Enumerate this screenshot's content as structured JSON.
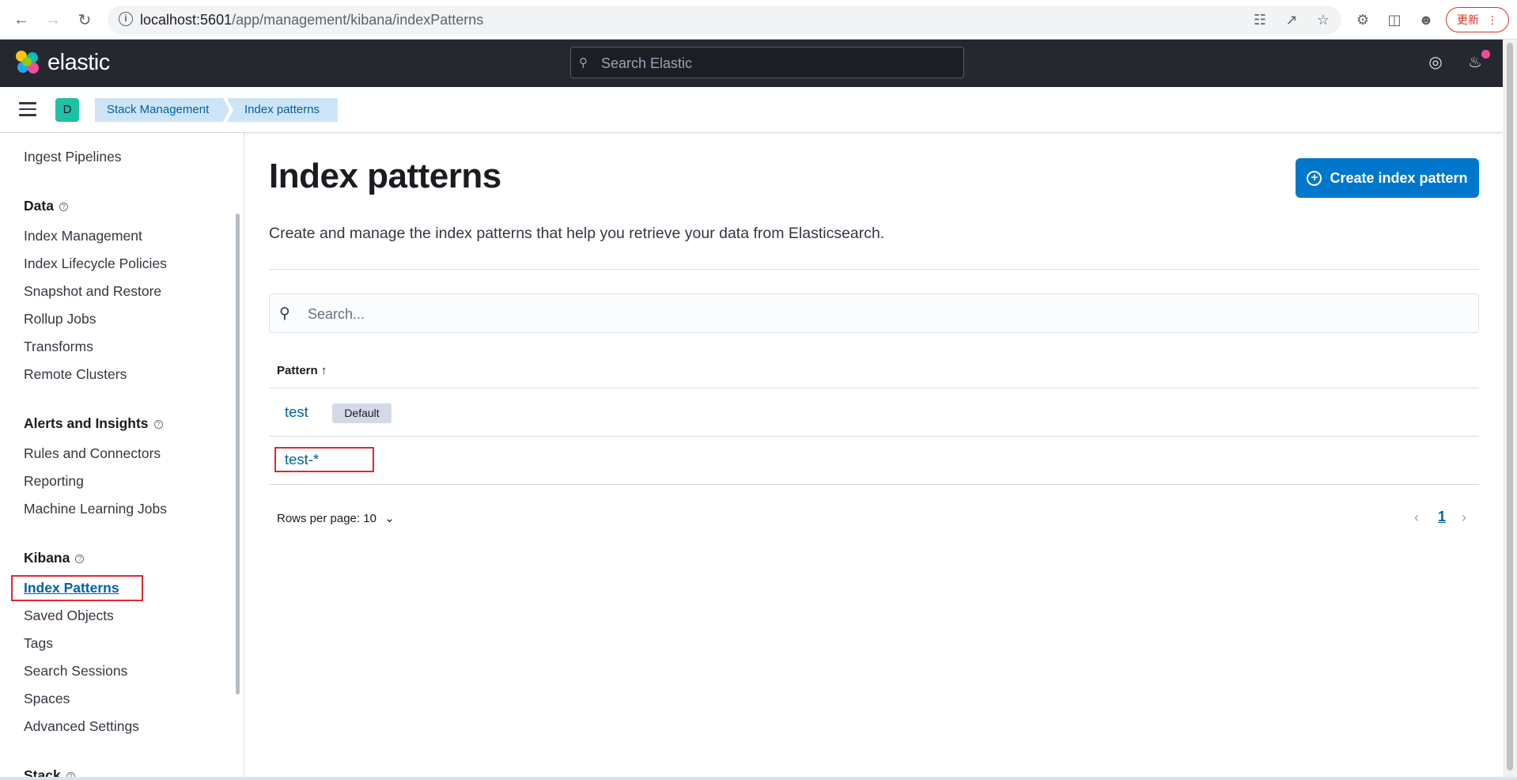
{
  "browser": {
    "url_host": "localhost:5601",
    "url_path": "/app/management/kibana/indexPatterns",
    "update_label": "更新"
  },
  "header": {
    "logo_text": "elastic",
    "search_placeholder": "Search Elastic"
  },
  "subheader": {
    "space_initial": "D",
    "breadcrumbs": [
      "Stack Management",
      "Index patterns"
    ]
  },
  "sidebar": {
    "top_item": "Ingest Pipelines",
    "groups": [
      {
        "title": "Data",
        "items": [
          "Index Management",
          "Index Lifecycle Policies",
          "Snapshot and Restore",
          "Rollup Jobs",
          "Transforms",
          "Remote Clusters"
        ]
      },
      {
        "title": "Alerts and Insights",
        "items": [
          "Rules and Connectors",
          "Reporting",
          "Machine Learning Jobs"
        ]
      },
      {
        "title": "Kibana",
        "items": [
          "Index Patterns",
          "Saved Objects",
          "Tags",
          "Search Sessions",
          "Spaces",
          "Advanced Settings"
        ]
      },
      {
        "title": "Stack",
        "items": []
      }
    ]
  },
  "main": {
    "title": "Index patterns",
    "create_button": "Create index pattern",
    "description": "Create and manage the index patterns that help you retrieve your data from Elasticsearch.",
    "search_placeholder": "Search...",
    "column_header": "Pattern",
    "rows": [
      {
        "pattern": "test",
        "badge": "Default"
      },
      {
        "pattern": "test-*",
        "badge": ""
      }
    ],
    "rows_per_page": "Rows per page: 10",
    "current_page": "1"
  },
  "colors": {
    "header_bg": "#25282f",
    "link": "#0061a6",
    "primary_button": "#0077cc",
    "highlight_box": "#e0262e"
  }
}
